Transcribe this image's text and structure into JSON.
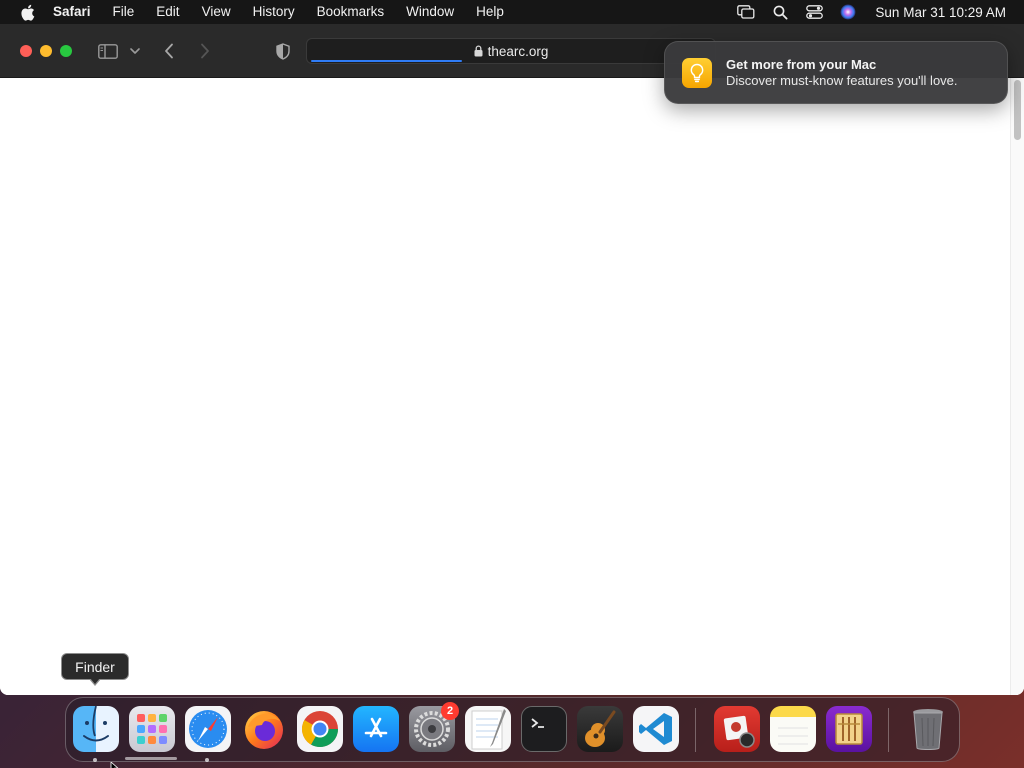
{
  "menubar": {
    "apple_icon": "apple-logo-icon",
    "app_name": "Safari",
    "items": [
      "File",
      "Edit",
      "View",
      "History",
      "Bookmarks",
      "Window",
      "Help"
    ],
    "status_icons": [
      "screen-mirroring-icon",
      "spotlight-search-icon",
      "control-center-icon",
      "siri-icon"
    ],
    "clock": "Sun Mar 31  10:29 AM"
  },
  "browser": {
    "address": "thearc.org",
    "secure": true,
    "load_progress": 0.37
  },
  "notification": {
    "icon": "lightbulb-icon",
    "title": "Get more from your Mac",
    "body": "Discover must-know features you'll love."
  },
  "tooltip": {
    "label": "Finder"
  },
  "dock": {
    "apps": [
      {
        "name": "Finder",
        "icon": "finder-icon",
        "running": true
      },
      {
        "name": "Launchpad",
        "icon": "launchpad-icon",
        "running": false
      },
      {
        "name": "Safari",
        "icon": "safari-icon",
        "running": true
      },
      {
        "name": "Firefox",
        "icon": "firefox-icon",
        "running": false
      },
      {
        "name": "Google Chrome",
        "icon": "chrome-icon",
        "running": false
      },
      {
        "name": "App Store",
        "icon": "app-store-icon",
        "running": false
      },
      {
        "name": "System Settings",
        "icon": "system-settings-icon",
        "running": false,
        "badge": "2"
      },
      {
        "name": "TextEdit",
        "icon": "textedit-icon",
        "running": false
      },
      {
        "name": "Terminal",
        "icon": "terminal-icon",
        "running": false
      },
      {
        "name": "GarageBand",
        "icon": "garageband-icon",
        "running": false
      },
      {
        "name": "Visual Studio Code",
        "icon": "vscode-icon",
        "running": false
      },
      {
        "name": "Photo Booth",
        "icon": "photo-booth-icon",
        "running": false
      },
      {
        "name": "Notes",
        "icon": "notes-icon",
        "running": false
      },
      {
        "name": "Abacus",
        "icon": "abacus-icon",
        "running": false
      },
      {
        "name": "Trash",
        "icon": "trash-icon",
        "running": false
      }
    ]
  },
  "colors": {
    "accent": "#2f7cf6",
    "close": "#fe5f57",
    "minimize": "#febc2e",
    "zoom": "#28c840",
    "badge": "#ff3b30"
  }
}
